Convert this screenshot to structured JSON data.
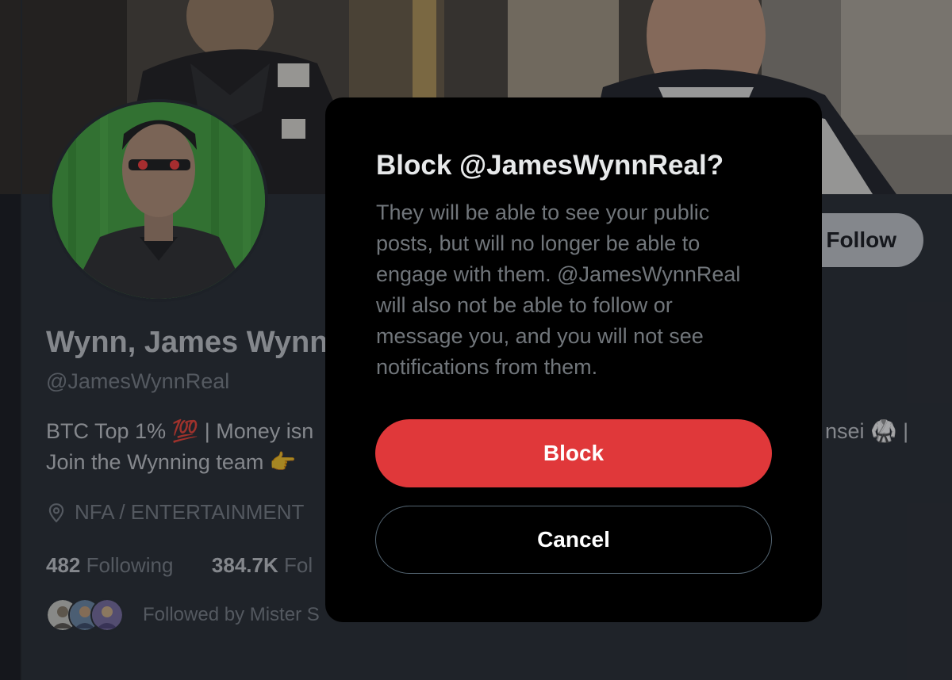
{
  "profile": {
    "name": "Wynn, James Wynn",
    "handle": "@JamesWynnReal",
    "bio_line1": "BTC Top 1% 💯 | Money isn",
    "bio_line1_right": "nsei 🥋 |",
    "bio_line2": "Join the Wynning team 👉",
    "location": "NFA / ENTERTAINMENT",
    "following_count": "482",
    "following_label": "Following",
    "followers_count": "384.7K",
    "followers_label_partial": "Fol",
    "followed_by_text": "Followed by Mister S",
    "follow_button_label": "Follow"
  },
  "modal": {
    "title": "Block @JamesWynnReal?",
    "description_lines": [
      "They will be able to see your public",
      "posts, but will no longer be able to",
      "engage with them. @JamesWynnReal",
      "will also not be able to follow or",
      "message you, and you will not see",
      "notifications from them."
    ],
    "block_label": "Block",
    "cancel_label": "Cancel"
  },
  "icons": {
    "location": "location-pin-icon"
  },
  "colors": {
    "page_bg": "#15181c",
    "profile_bg": "#262a31",
    "modal_bg": "#000000",
    "block_red": "#e0383a",
    "primary_text": "#e7e9ea",
    "secondary_text": "#71767b"
  }
}
